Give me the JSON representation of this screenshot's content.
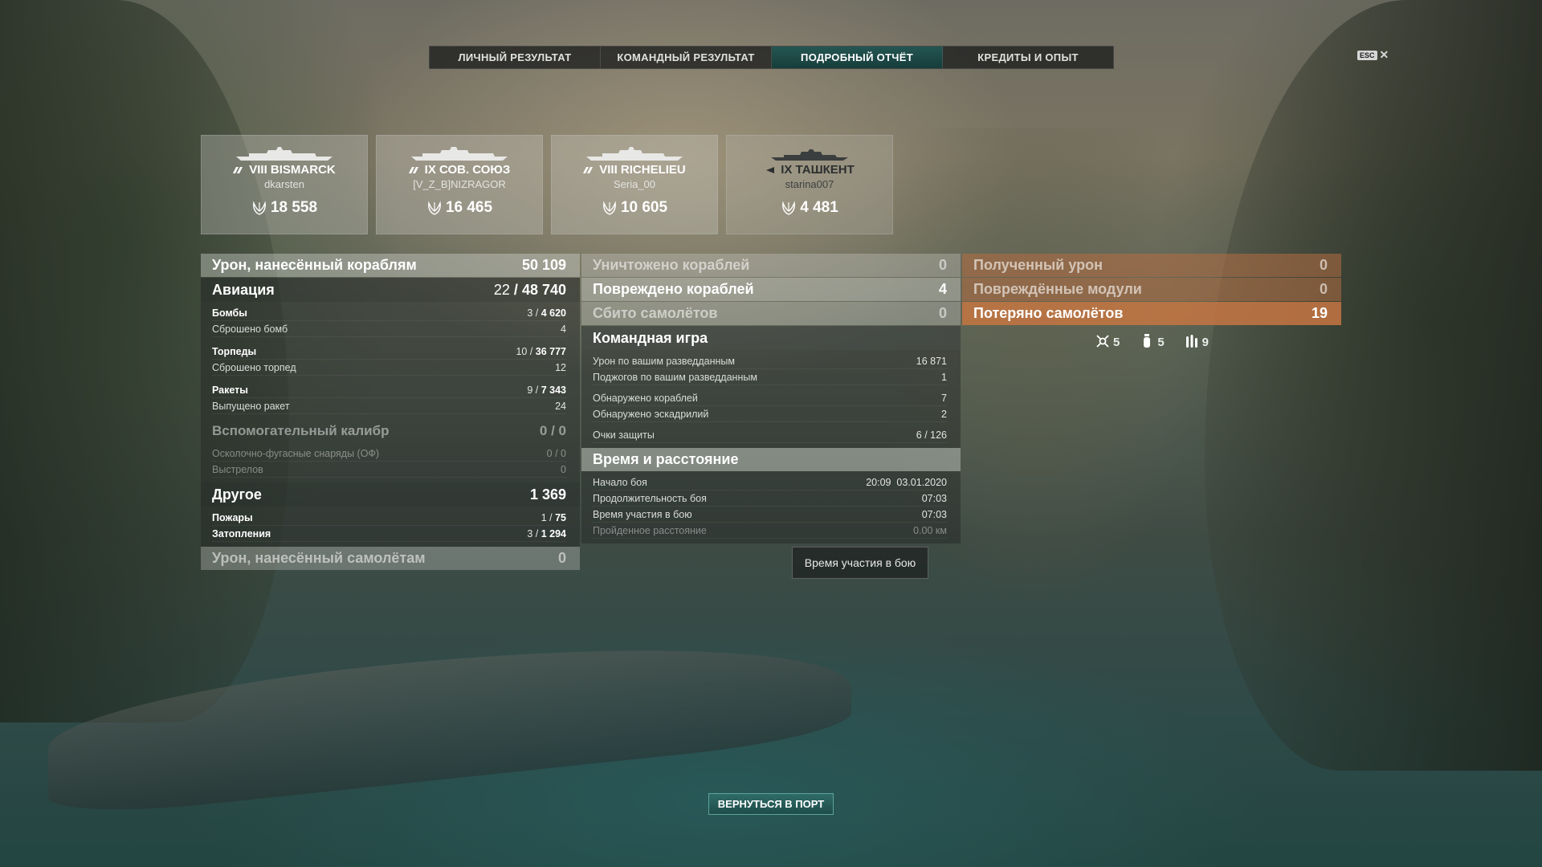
{
  "tabs": [
    {
      "label": "ЛИЧНЫЙ РЕЗУЛЬТАТ"
    },
    {
      "label": "КОМАНДНЫЙ РЕЗУЛЬТАТ"
    },
    {
      "label": "ПОДРОБНЫЙ ОТЧЁТ"
    },
    {
      "label": "КРЕДИТЫ И ОПЫТ"
    }
  ],
  "esc": {
    "key": "ESC",
    "close": "✕"
  },
  "ships": [
    {
      "name": "VIII BISMARCK",
      "player": "dkarsten",
      "score": "18 558"
    },
    {
      "name": "IX СОВ. СОЮЗ",
      "player": "[V_Z_B]NIZRAGOR",
      "score": "16 465"
    },
    {
      "name": "VIII RICHELIEU",
      "player": "Seria_00",
      "score": "10 605"
    },
    {
      "name": "IX ТАШКЕНТ",
      "player": "starina007",
      "score": "4 481"
    }
  ],
  "left": {
    "damage": {
      "label": "Урон, нанесённый кораблям",
      "value": "50 109"
    },
    "aviation": {
      "label": "Авиация",
      "hits": "22",
      "value": "48 740"
    },
    "bombs": {
      "label": "Бомбы",
      "hits": "3",
      "value": "4 620"
    },
    "bombs_dropped": {
      "label": "Сброшено бомб",
      "value": "4"
    },
    "torps": {
      "label": "Торпеды",
      "hits": "10",
      "value": "36 777"
    },
    "torps_dropped": {
      "label": "Сброшено торпед",
      "value": "12"
    },
    "rockets": {
      "label": "Ракеты",
      "hits": "9",
      "value": "7 343"
    },
    "rockets_fired": {
      "label": "Выпущено ракет",
      "value": "24"
    },
    "secondary": {
      "label": "Вспомогательный калибр",
      "value": "0 / 0"
    },
    "he": {
      "label": "Осколочно-фугасные снаряды (ОФ)",
      "value": "0 / 0"
    },
    "shots": {
      "label": "Выстрелов",
      "value": "0"
    },
    "other": {
      "label": "Другое",
      "value": "1 369"
    },
    "fires": {
      "label": "Пожары",
      "hits": "1",
      "value": "75"
    },
    "floods": {
      "label": "Затопления",
      "hits": "3",
      "value": "1 294"
    },
    "planes_damage": {
      "label": "Урон, нанесённый самолётам",
      "value": "0"
    }
  },
  "middle": {
    "destroyed": {
      "label": "Уничтожено кораблей",
      "value": "0"
    },
    "damaged": {
      "label": "Повреждено кораблей",
      "value": "4"
    },
    "planes_shot": {
      "label": "Сбито самолётов",
      "value": "0"
    },
    "team": {
      "label": "Командная игра"
    },
    "spot_damage": {
      "label": "Урон по вашим разведданным",
      "value": "16 871"
    },
    "spot_fires": {
      "label": "Поджогов по вашим разведданным",
      "value": "1"
    },
    "spotted_ships": {
      "label": "Обнаружено кораблей",
      "value": "7"
    },
    "spotted_squads": {
      "label": "Обнаружено эскадрилий",
      "value": "2"
    },
    "defense": {
      "label": "Очки защиты",
      "value": "6 / 126"
    },
    "time": {
      "label": "Время и расстояние"
    },
    "start": {
      "label": "Начало боя",
      "value": "20:09  03.01.2020"
    },
    "duration": {
      "label": "Продолжительность боя",
      "value": "07:03"
    },
    "participation": {
      "label": "Время участия в бою",
      "value": "07:03"
    },
    "distance": {
      "label": "Пройденное расстояние",
      "value": "0.00 км"
    }
  },
  "right": {
    "received": {
      "label": "Полученный урон",
      "value": "0"
    },
    "modules": {
      "label": "Повреждённые модули",
      "value": "0"
    },
    "lost_planes": {
      "label": "Потеряно самолётов",
      "value": "19"
    },
    "icons": [
      {
        "icon": "fighter-icon",
        "value": "5"
      },
      {
        "icon": "bomb-icon",
        "value": "5"
      },
      {
        "icon": "torpedo-icon",
        "value": "9"
      }
    ]
  },
  "tooltip": "Время участия в бою",
  "back_button": "ВЕРНУТЬСЯ В ПОРТ"
}
